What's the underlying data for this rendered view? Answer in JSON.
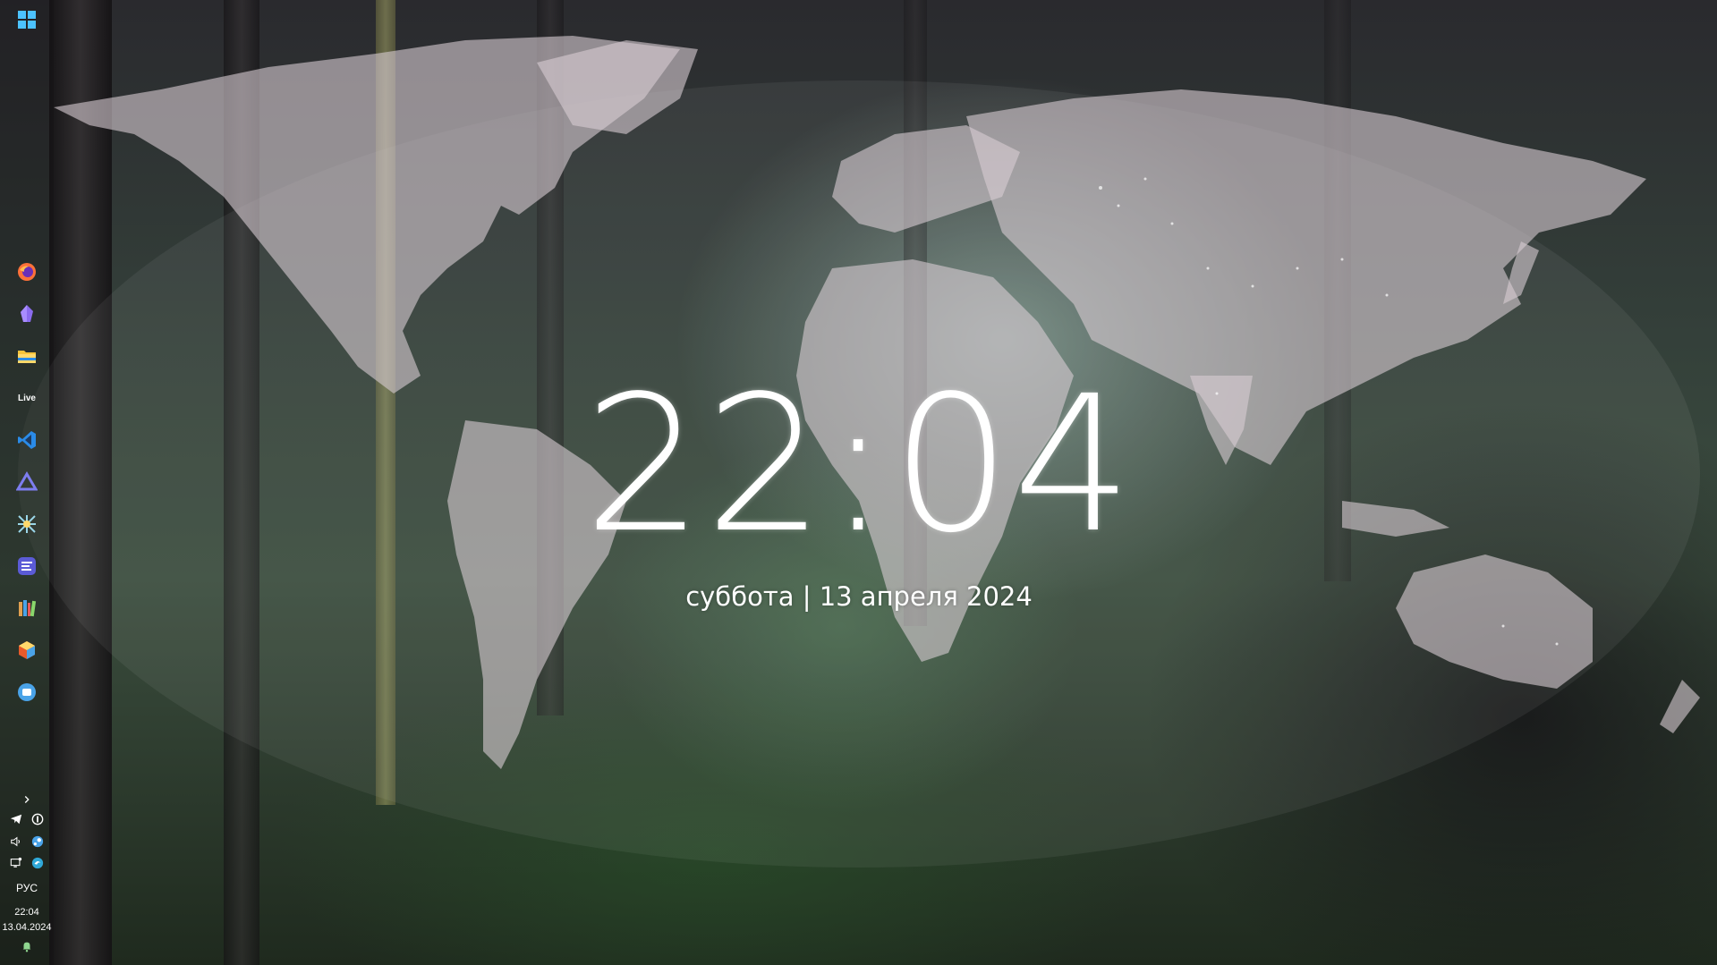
{
  "clock": {
    "time": "22:04",
    "date_line": "суббота | 13 апреля 2024"
  },
  "taskbar": {
    "orientation": "vertical-left",
    "start_button": {
      "icon": "windows-start-icon"
    },
    "pinned_apps": [
      {
        "icon": "firefox-icon",
        "accent": "#ff7139"
      },
      {
        "icon": "obsidian-icon",
        "accent": "#8b6cef"
      },
      {
        "icon": "file-explorer-icon",
        "accent": "#f5c33b"
      },
      {
        "icon": "live-app-icon",
        "label": "Live"
      },
      {
        "icon": "vscode-icon",
        "accent": "#2a8be8"
      },
      {
        "icon": "triangle-app-icon",
        "accent": "#7d7df0"
      },
      {
        "icon": "network-app-icon",
        "accent": "#9ad6e8"
      },
      {
        "icon": "menu-app-icon",
        "accent": "#5b5bd6"
      },
      {
        "icon": "books-icon",
        "accent": "#e0a050"
      },
      {
        "icon": "cube-app-icon",
        "accent": "#e85a2a"
      },
      {
        "icon": "messenger-app-icon",
        "accent": "#4aa3e8"
      }
    ],
    "tray": {
      "expand_icon": "chevron-right-icon",
      "icons": [
        "telegram-icon",
        "circle-app-icon",
        "volume-icon",
        "steam-icon",
        "display-icon",
        "edge-icon"
      ],
      "language": "РУС",
      "time": "22:04",
      "date": "13.04.2024",
      "notification_icon": "bell-icon"
    }
  },
  "colors": {
    "text": "#ffffff",
    "map_land": "#d8cdd3"
  }
}
